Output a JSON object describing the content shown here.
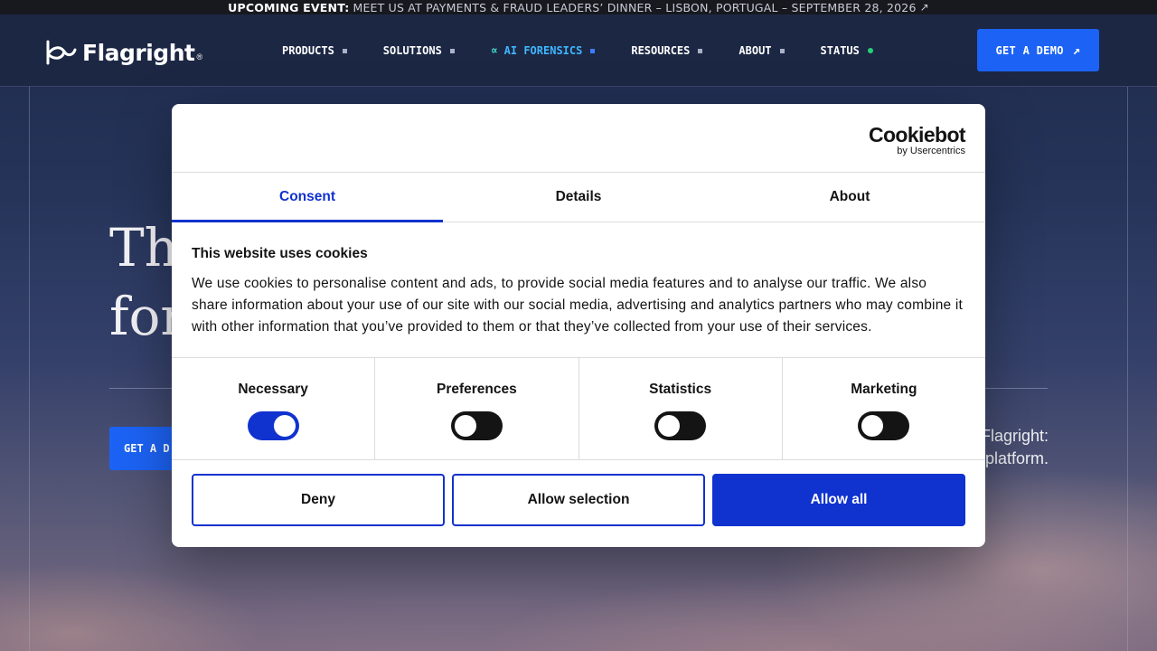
{
  "announcement": {
    "lead": "UPCOMING EVENT:",
    "text": "MEET US AT PAYMENTS & FRAUD LEADERS’ DINNER – LISBON, PORTUGAL – SEPTEMBER 28, 2026",
    "icon": "arrow-up-right-icon"
  },
  "nav": {
    "logo": "Flagright",
    "logo_mark": "®",
    "items": [
      {
        "label": "PRODUCTS"
      },
      {
        "label": "SOLUTIONS"
      },
      {
        "label": "AI FORENSICS"
      },
      {
        "label": "RESOURCES"
      },
      {
        "label": "ABOUT"
      },
      {
        "label": "STATUS"
      }
    ],
    "cta": "GET A DEMO",
    "colors": {
      "accent": "#1c63f5",
      "ai": "#3fb7ff",
      "status_ok": "#27d07a"
    }
  },
  "hero": {
    "title_line1": "Th",
    "title_line2": "for",
    "cta": "GET A D",
    "side_line1": "Flagright:",
    "side_line2": "platform."
  },
  "cookie": {
    "brand": "Cookiebot",
    "brand_sub": "by Usercentrics",
    "tabs": [
      {
        "label": "Consent",
        "active": true
      },
      {
        "label": "Details",
        "active": false
      },
      {
        "label": "About",
        "active": false
      }
    ],
    "title": "This website uses cookies",
    "text": "We use cookies to personalise content and ads, to provide social media features and to analyse our traffic. We also share information about your use of our site with our social media, advertising and analytics partners who may combine it with other information that you’ve provided to them or that they’ve collected from your use of their services.",
    "toggles": [
      {
        "label": "Necessary",
        "on": true
      },
      {
        "label": "Preferences",
        "on": false
      },
      {
        "label": "Statistics",
        "on": false
      },
      {
        "label": "Marketing",
        "on": false
      }
    ],
    "buttons": {
      "deny": "Deny",
      "selection": "Allow selection",
      "all": "Allow all"
    },
    "colors": {
      "primary": "#1032cf"
    }
  }
}
